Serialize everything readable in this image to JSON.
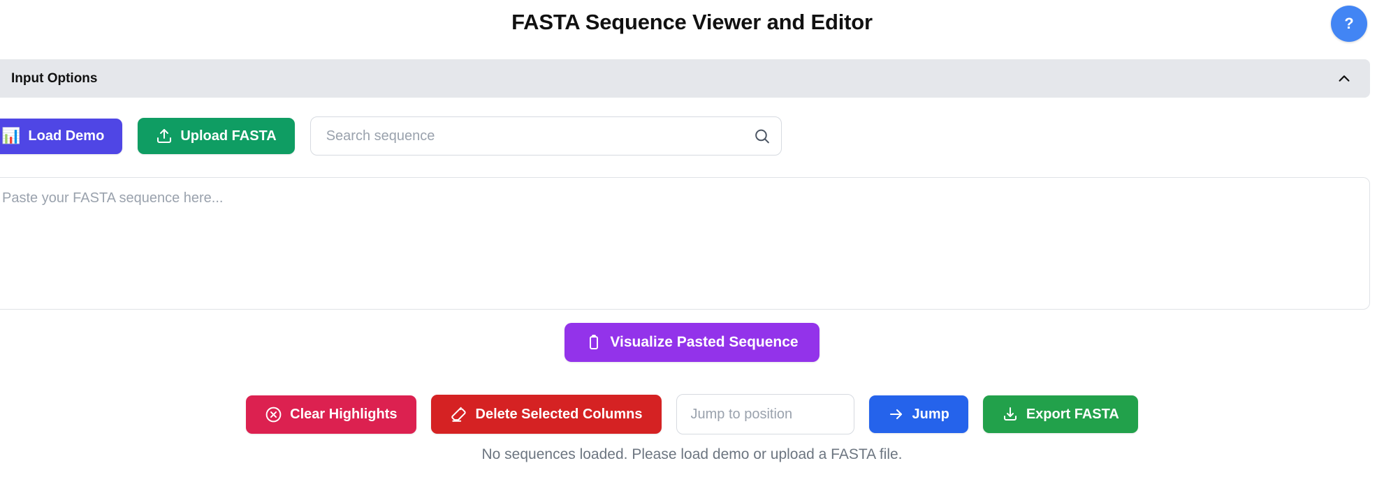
{
  "header": {
    "title": "FASTA Sequence Viewer and Editor",
    "help_label": "?",
    "help_icon": "question-mark-icon"
  },
  "accordion": {
    "title": "Input Options",
    "toggle_icon": "chevron-up-icon",
    "expanded": true
  },
  "input_options": {
    "load_demo": {
      "label": "Load Demo",
      "icon": "bar-chart-icon",
      "emoji": "📊",
      "color": "#4f46e5"
    },
    "upload_fasta": {
      "label": "Upload FASTA",
      "icon": "upload-icon",
      "color": "#0f9d63"
    },
    "search": {
      "placeholder": "Search sequence",
      "value": "",
      "icon": "search-icon"
    },
    "paste": {
      "placeholder": "Paste your FASTA sequence here...",
      "value": ""
    }
  },
  "visualize": {
    "label": "Visualize Pasted Sequence",
    "icon": "clipboard-icon",
    "color": "#9333ea"
  },
  "toolbar": {
    "clear_highlights": {
      "label": "Clear Highlights",
      "icon": "x-circle-icon",
      "color": "#dc2150"
    },
    "delete_columns": {
      "label": "Delete Selected Columns",
      "icon": "eraser-icon",
      "color": "#d52223"
    },
    "jump_position": {
      "placeholder": "Jump to position",
      "value": ""
    },
    "jump": {
      "label": "Jump",
      "icon": "arrow-right-icon",
      "color": "#2563eb"
    },
    "export_fasta": {
      "label": "Export FASTA",
      "icon": "download-icon",
      "color": "#22a14b"
    }
  },
  "status": {
    "message": "No sequences loaded. Please load demo or upload a FASTA file."
  }
}
